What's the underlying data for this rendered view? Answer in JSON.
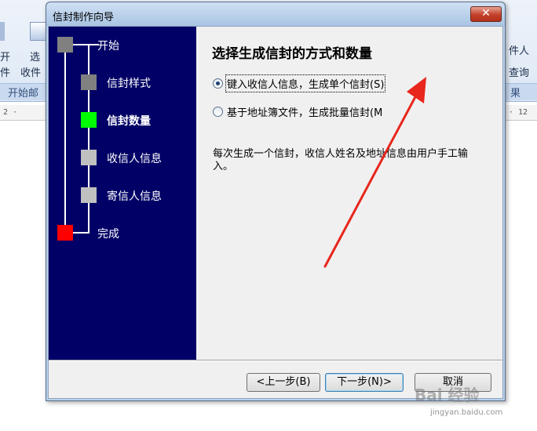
{
  "background_app": {
    "ribbon_texts": [
      "选",
      "件",
      "开",
      "收件",
      "件人",
      "查询",
      "果",
      "开始邮"
    ],
    "ruler_left": "2 · ",
    "ruler_right": "· 12"
  },
  "dialog": {
    "title": "信封制作向导",
    "close_label": "✕"
  },
  "nav": {
    "steps": [
      {
        "label": "开始",
        "color": "#808080"
      },
      {
        "label": "信封样式",
        "color": "#808080"
      },
      {
        "label": "信封数量",
        "color": "#00ff00"
      },
      {
        "label": "收信人信息",
        "color": "#c0c0c0"
      },
      {
        "label": "寄信人信息",
        "color": "#c0c0c0"
      },
      {
        "label": "完成",
        "color": "#ff0000"
      }
    ],
    "active_index": 2
  },
  "content": {
    "heading": "选择生成信封的方式和数量",
    "option_single": "键入收信人信息，生成单个信封(S)",
    "option_batch": "基于地址簿文件，生成批量信封(M",
    "description": "每次生成一个信封，收信人姓名及地址信息由用户手工输入。"
  },
  "buttons": {
    "prev": "<上一步(B)",
    "next": "下一步(N)>",
    "cancel": "取消"
  },
  "annotation_color": "#e8261c",
  "watermark": {
    "main": "Bai 经验",
    "sub": "jingyan.baidu.com"
  }
}
